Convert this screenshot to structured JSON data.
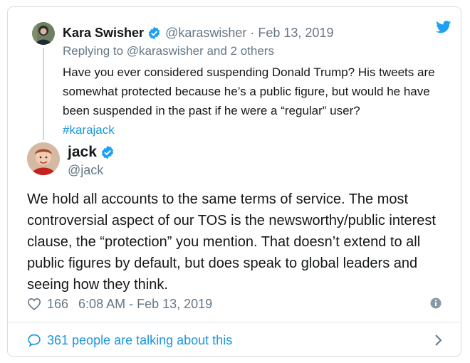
{
  "reply": {
    "name": "Kara Swisher",
    "handle": "@karaswisher",
    "separator": "·",
    "date": "Feb 13, 2019",
    "replying_to": "Replying to @karaswisher and 2 others",
    "body": "Have you ever considered suspending Donald Trump? His tweets are somewhat protected because he’s a public figure, but would he have been suspended in the past if he were a “regular” user?",
    "hashtag": "#karajack"
  },
  "tweet": {
    "name": "jack",
    "handle": "@jack",
    "body": "We hold all accounts to the same terms of service. The most controversial aspect of our TOS is the newsworthy/public interest clause, the “protection” you mention. That doesn’t extend to all public figures by default, but does speak to global leaders and seeing how they think.",
    "likes": "166",
    "timestamp": "6:08 AM - Feb 13, 2019"
  },
  "footer": {
    "talking": "361 people are talking about this"
  },
  "colors": {
    "accent": "#1b95e0",
    "muted": "#657786",
    "text": "#14171a",
    "border": "#d8dee3"
  },
  "icons": {
    "brand": "twitter-bird-icon",
    "verified": "verified-badge-icon",
    "like": "heart-icon",
    "info": "info-icon",
    "comment": "comment-bubble-icon",
    "chevron": "chevron-right-icon"
  }
}
